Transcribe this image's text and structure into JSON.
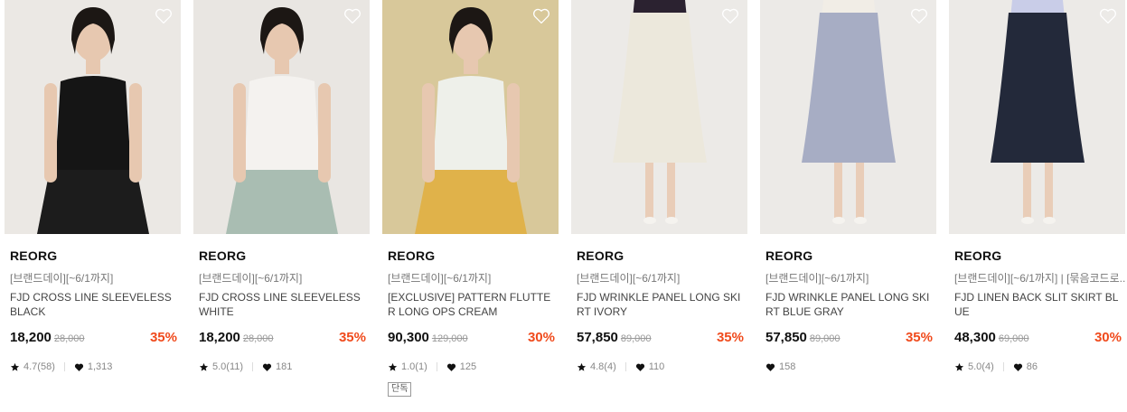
{
  "products": [
    {
      "brand": "REORG",
      "promo": "[브랜드데이][~6/1까지]",
      "name": "FJD CROSS LINE SLEEVELESS BLACK",
      "price": "18,200",
      "original_price": "28,000",
      "discount": "35%",
      "rating": "4.7(58)",
      "likes": "1,313",
      "tag": null,
      "bg_color": "#ebe8e4",
      "garment_color": "#151515",
      "bottom_color": "#1c1c1c"
    },
    {
      "brand": "REORG",
      "promo": "[브랜드데이][~6/1까지]",
      "name": "FJD CROSS LINE SLEEVELESS WHITE",
      "price": "18,200",
      "original_price": "28,000",
      "discount": "35%",
      "rating": "5.0(11)",
      "likes": "181",
      "tag": null,
      "bg_color": "#e9e6e2",
      "garment_color": "#f4f2ef",
      "bottom_color": "#a9bdb2"
    },
    {
      "brand": "REORG",
      "promo": "[브랜드데이][~6/1까지]",
      "name": "[EXCLUSIVE] PATTERN FLUTTER LONG OPS CREAM",
      "price": "90,300",
      "original_price": "129,000",
      "discount": "30%",
      "rating": "1.0(1)",
      "likes": "125",
      "tag": "단독",
      "bg_color": "#d8c89a",
      "garment_color": "#eef0ea",
      "bottom_color": "#e0b24a"
    },
    {
      "brand": "REORG",
      "promo": "[브랜드데이][~6/1까지]",
      "name": "FJD WRINKLE PANEL LONG SKIRT IVORY",
      "price": "57,850",
      "original_price": "89,000",
      "discount": "35%",
      "rating": "4.8(4)",
      "likes": "110",
      "tag": null,
      "bg_color": "#eceae7",
      "garment_color": "#ece8dc",
      "bottom_color": "#2b2230"
    },
    {
      "brand": "REORG",
      "promo": "[브랜드데이][~6/1까지]",
      "name": "FJD WRINKLE PANEL LONG SKIRT BLUE GRAY",
      "price": "57,850",
      "original_price": "89,000",
      "discount": "35%",
      "rating": null,
      "likes": "158",
      "tag": null,
      "bg_color": "#eceae7",
      "garment_color": "#a7adc4",
      "bottom_color": "#f1ede6"
    },
    {
      "brand": "REORG",
      "promo": "[브랜드데이][~6/1까지] | [묶음코드로...",
      "name": "FJD LINEN BACK SLIT SKIRT BLUE",
      "price": "48,300",
      "original_price": "69,000",
      "discount": "30%",
      "rating": "5.0(4)",
      "likes": "86",
      "tag": null,
      "bg_color": "#eceae7",
      "garment_color": "#23293a",
      "bottom_color": "#c9cde8"
    }
  ],
  "icons": {
    "wishlist": "heart-outline-icon",
    "rating": "star-icon",
    "likes": "heart-icon"
  },
  "colors": {
    "discount": "#f04a1c",
    "brand_text": "#111111",
    "muted_text": "#888888"
  }
}
